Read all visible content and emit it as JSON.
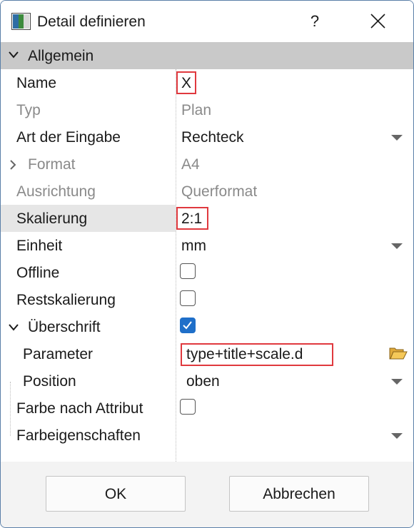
{
  "window": {
    "title": "Detail definieren",
    "help_label": "?"
  },
  "section": {
    "label": "Allgemein"
  },
  "rows": [
    {
      "name": "Name",
      "value": "X"
    },
    {
      "name": "Typ",
      "value": "Plan"
    },
    {
      "name": "Art der Eingabe",
      "value": "Rechteck"
    },
    {
      "name": "Format",
      "value": "A4"
    },
    {
      "name": "Ausrichtung",
      "value": "Querformat"
    },
    {
      "name": "Skalierung",
      "value": "2:1"
    },
    {
      "name": "Einheit",
      "value": "mm"
    },
    {
      "name": "Offline",
      "checked": false
    },
    {
      "name": "Restskalierung",
      "checked": false
    },
    {
      "name": "Überschrift",
      "checked": true
    },
    {
      "name": "Parameter",
      "value": "type+title+scale.d"
    },
    {
      "name": "Position",
      "value": "oben"
    },
    {
      "name": "Farbe nach Attribut",
      "checked": false
    },
    {
      "name": "Farbeigenschaften",
      "value": ""
    }
  ],
  "buttons": {
    "ok": "OK",
    "cancel": "Abbrechen"
  },
  "colors": {
    "accent": "#1f6fc9",
    "highlight": "#e0393e",
    "section_bg": "#c9c9c9"
  }
}
